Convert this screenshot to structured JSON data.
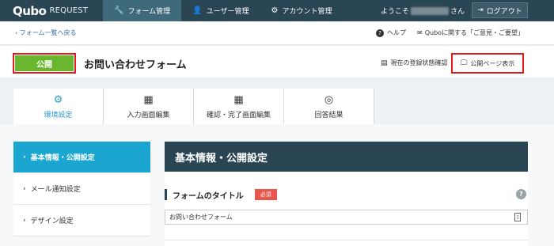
{
  "logo": {
    "mark": "Qubo",
    "sub": "REQUEST"
  },
  "nav": {
    "tabs": [
      {
        "label": "フォーム管理",
        "icon": "wrench-icon"
      },
      {
        "label": "ユーザー管理",
        "icon": "user-icon"
      },
      {
        "label": "アカウント管理",
        "icon": "gear-icon"
      }
    ],
    "welcome_prefix": "ようこそ",
    "welcome_suffix": "さん",
    "logout_label": "ログアウト"
  },
  "subbar": {
    "back_label": "フォーム一覧へ戻る",
    "help_label": "ヘルプ",
    "feedback_label": "Quboに関する「ご意見・ご要望」"
  },
  "form": {
    "status_label": "公開",
    "title": "お問い合わせフォーム",
    "reg_status_label": "現在の登録状態確認",
    "public_page_label": "公開ページ表示"
  },
  "tabs": [
    {
      "label": "環境設定",
      "icon": "gear-icon",
      "active": true
    },
    {
      "label": "入力画面編集",
      "icon": "edit-table-icon",
      "active": false
    },
    {
      "label": "確認・完了画面編集",
      "icon": "edit-table-icon",
      "active": false
    },
    {
      "label": "回答結果",
      "icon": "globe-icon",
      "active": false
    }
  ],
  "sidebar": {
    "items": [
      {
        "label": "基本情報・公開設定",
        "active": true
      },
      {
        "label": "メール通知設定",
        "active": false
      },
      {
        "label": "デザイン設定",
        "active": false
      }
    ]
  },
  "panel": {
    "heading": "基本情報・公開設定",
    "field_label": "フォームのタイトル",
    "required_badge": "必須",
    "field_value": "お問い合わせフォーム"
  },
  "colors": {
    "nav_bg": "#2a4654",
    "accent": "#1aa6d1",
    "public_green": "#6ab72f",
    "highlight_red": "#e21b22",
    "required_red": "#e8574c"
  }
}
